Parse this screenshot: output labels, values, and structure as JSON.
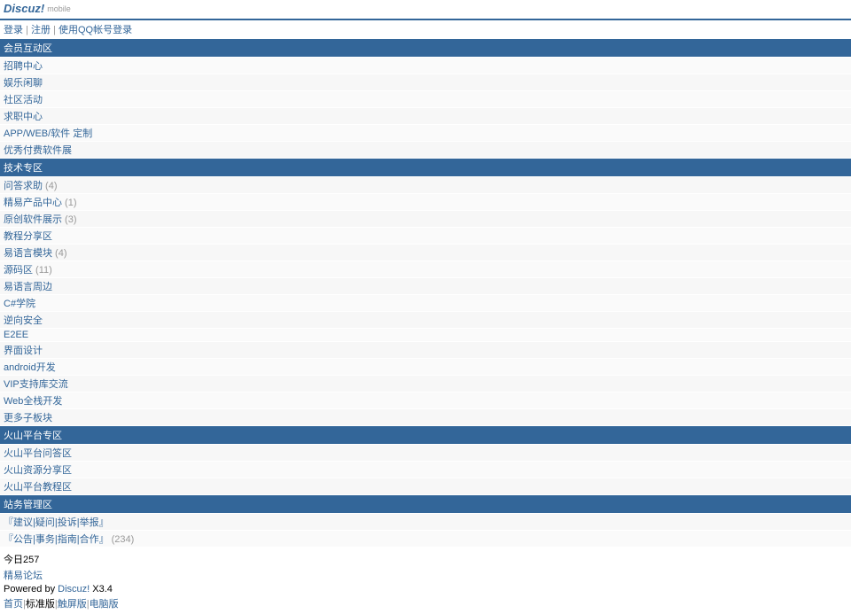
{
  "header": {
    "logo_main": "Discuz!",
    "logo_sub": "mobile"
  },
  "auth": {
    "login": "登录",
    "register": "注册",
    "qq_login": "使用QQ帐号登录"
  },
  "sections": [
    {
      "title": "会员互动区",
      "items": [
        {
          "label": "招聘中心",
          "count": ""
        },
        {
          "label": "娱乐闲聊",
          "count": ""
        },
        {
          "label": "社区活动",
          "count": ""
        },
        {
          "label": "求职中心",
          "count": ""
        },
        {
          "label": "APP/WEB/软件 定制",
          "count": ""
        },
        {
          "label": "优秀付费软件展",
          "count": ""
        }
      ]
    },
    {
      "title": "技术专区",
      "items": [
        {
          "label": "问答求助",
          "count": "(4)"
        },
        {
          "label": "精易产品中心",
          "count": "(1)"
        },
        {
          "label": "原创软件展示",
          "count": "(3)"
        },
        {
          "label": "教程分享区",
          "count": ""
        },
        {
          "label": "易语言模块",
          "count": "(4)"
        },
        {
          "label": "源码区",
          "count": "(11)"
        },
        {
          "label": "易语言周边",
          "count": ""
        },
        {
          "label": "C#学院",
          "count": ""
        },
        {
          "label": "逆向安全",
          "count": ""
        },
        {
          "label": "E2EE",
          "count": ""
        },
        {
          "label": "界面设计",
          "count": ""
        },
        {
          "label": "android开发",
          "count": ""
        },
        {
          "label": "VIP支持库交流",
          "count": ""
        },
        {
          "label": "Web全栈开发",
          "count": ""
        },
        {
          "label": "更多子板块",
          "count": ""
        }
      ]
    },
    {
      "title": "火山平台专区",
      "items": [
        {
          "label": "火山平台问答区",
          "count": ""
        },
        {
          "label": "火山资源分享区",
          "count": ""
        },
        {
          "label": "火山平台教程区",
          "count": ""
        }
      ]
    },
    {
      "title": "站务管理区",
      "items": [
        {
          "label": "『建议|疑问|投诉|举报』",
          "count": ""
        },
        {
          "label": "『公告|事务|指南|合作』",
          "count": "(234)"
        }
      ]
    }
  ],
  "footer": {
    "today": "今日257",
    "site_name": "精易论坛",
    "powered_by": "Powered by ",
    "discuz": "Discuz!",
    "version": " X3.4",
    "nav_home": "首页",
    "nav_standard": "标准版",
    "nav_touch": "触屏版",
    "nav_desktop": "电脑版"
  }
}
